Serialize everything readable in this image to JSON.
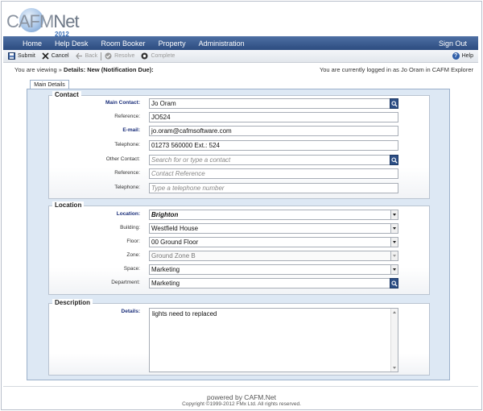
{
  "app": {
    "logo_main": "CAFM",
    "logo_net": "Net",
    "logo_year": "2012"
  },
  "nav": {
    "items": [
      "Home",
      "Help Desk",
      "Room Booker",
      "Property",
      "Administration"
    ],
    "signout": "Sign Out"
  },
  "toolbar": {
    "submit": "Submit",
    "cancel": "Cancel",
    "back": "Back",
    "resolve": "Resolve",
    "complete": "Complete",
    "help": "Help",
    "icons": {
      "submit": "save-icon",
      "cancel": "close-icon",
      "back": "back-arrow-icon",
      "resolve": "check-circle-icon",
      "complete": "complete-circle-icon",
      "help": "help-icon"
    }
  },
  "status": {
    "viewing_prefix": "You are viewing »",
    "viewing_page": "Details: New (Notification Due):",
    "logged_in": "You are currently logged in as Jo Oram in CAFM Explorer"
  },
  "tabs": [
    "Main Details"
  ],
  "contact": {
    "title": "Contact",
    "main_contact": {
      "label": "Main Contact:",
      "value": "Jo Oram"
    },
    "reference": {
      "label": "Reference:",
      "value": "JO524"
    },
    "email": {
      "label": "E-mail:",
      "value": "jo.oram@cafmsoftware.com"
    },
    "telephone": {
      "label": "Telephone:",
      "value": "01273 560000 Ext.: 524"
    },
    "other_contact": {
      "label": "Other Contact:",
      "placeholder": "Search for or type a contact"
    },
    "other_reference": {
      "label": "Reference:",
      "placeholder": "Contact Reference"
    },
    "other_telephone": {
      "label": "Telephone:",
      "placeholder": "Type a telephone number"
    }
  },
  "location": {
    "title": "Location",
    "location": {
      "label": "Location:",
      "value": "Brighton"
    },
    "building": {
      "label": "Building:",
      "value": "Westfield House"
    },
    "floor": {
      "label": "Floor:",
      "value": "00 Ground Floor"
    },
    "zone": {
      "label": "Zone:",
      "value": "Ground Zone B"
    },
    "space": {
      "label": "Space:",
      "value": "Marketing"
    },
    "department": {
      "label": "Department:",
      "value": "Marketing"
    }
  },
  "description": {
    "title": "Description",
    "details": {
      "label": "Details:",
      "value": "lights need to replaced"
    }
  },
  "footer": {
    "powered": "powered by CAFM.Net",
    "copyright": "Copyright ©1999-2012 FMx Ltd. All rights reserved."
  },
  "colors": {
    "nav_bg": "#3a5c91",
    "panel_bg": "#dde8f4",
    "search_button": "#2d4f86",
    "required_label": "#1b2f7a"
  }
}
